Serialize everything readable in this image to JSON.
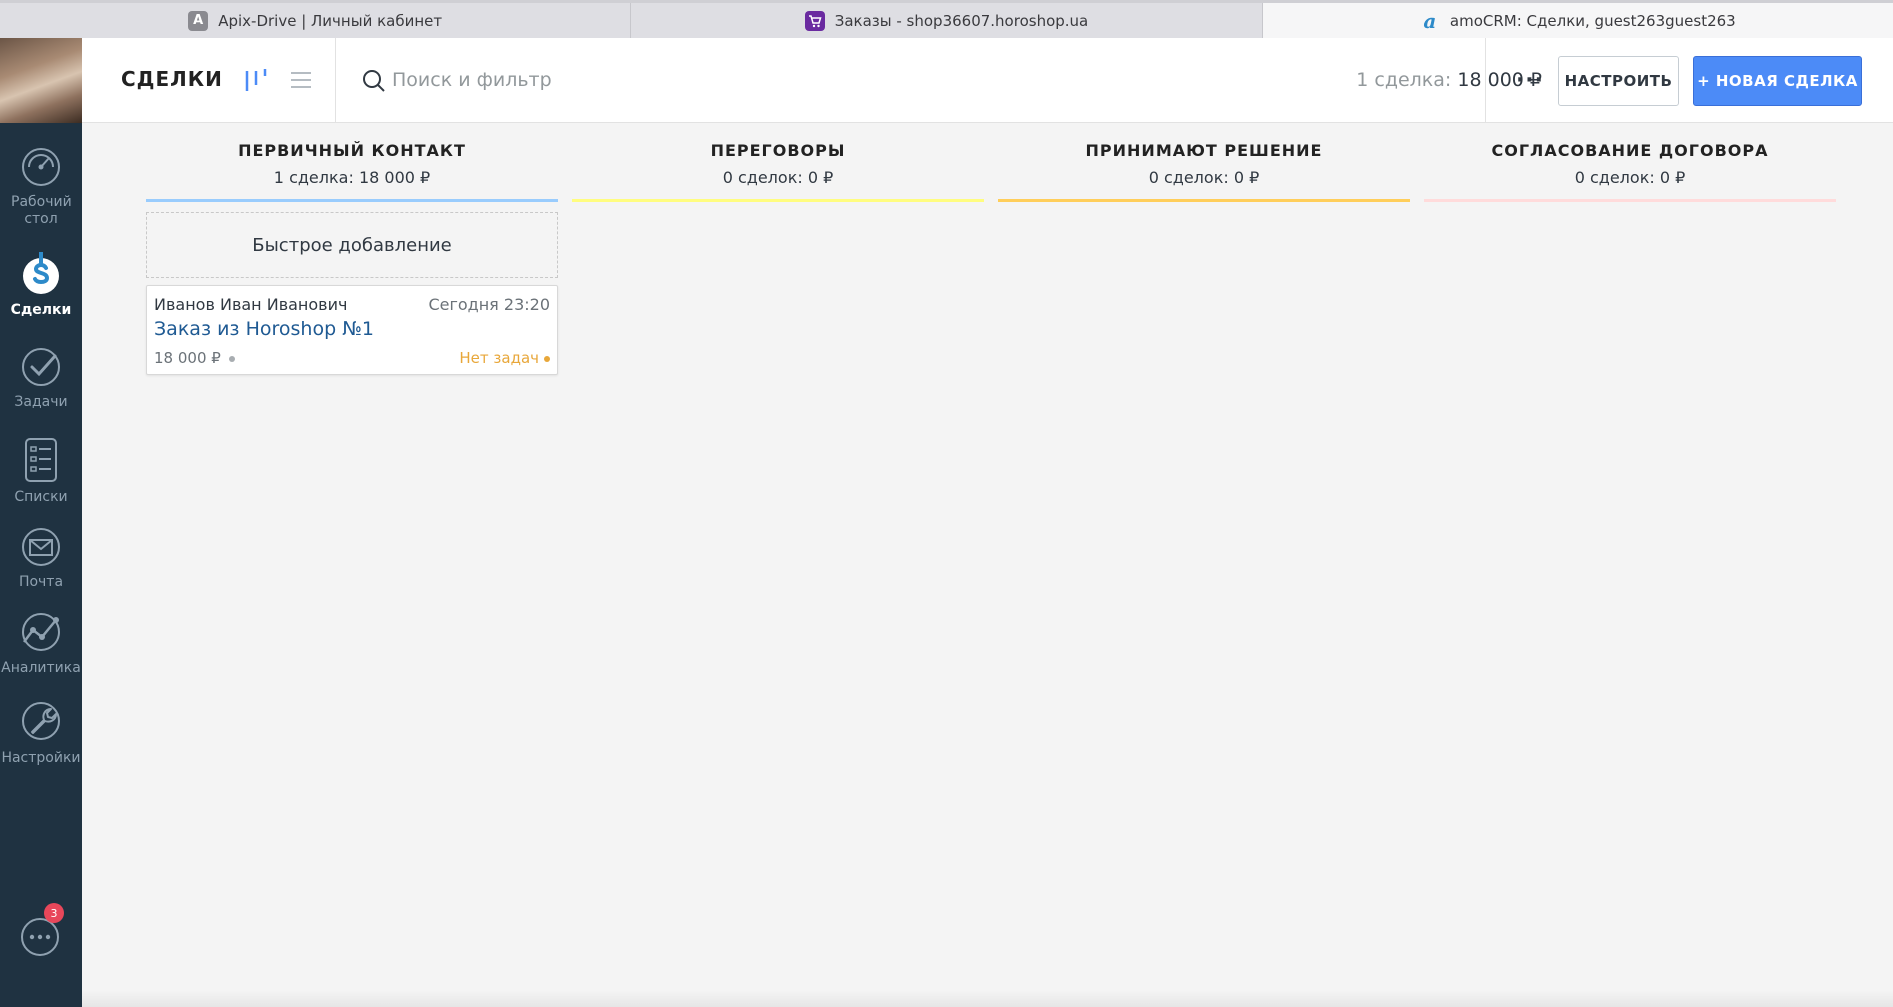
{
  "browser": {
    "tabs": [
      {
        "title": "Apix-Drive | Личный кабинет",
        "icon": "letter-a-icon",
        "favicon_text": "A"
      },
      {
        "title": "Заказы - shop36607.horoshop.ua",
        "icon": "cart-icon"
      },
      {
        "title": "amoCRM: Сделки, guest263guest263",
        "icon": "amo-logo-icon",
        "favicon_text": "a"
      }
    ]
  },
  "sidebar": {
    "items": [
      {
        "label": "Рабочий стол",
        "icon": "dashboard-icon",
        "active": false
      },
      {
        "label": "Сделки",
        "icon": "deals-icon",
        "active": true
      },
      {
        "label": "Задачи",
        "icon": "tasks-icon",
        "active": false
      },
      {
        "label": "Списки",
        "icon": "lists-icon",
        "active": false
      },
      {
        "label": "Почта",
        "icon": "mail-icon",
        "active": false
      },
      {
        "label": "Аналитика",
        "icon": "analytics-icon",
        "active": false
      },
      {
        "label": "Настройки",
        "icon": "settings-icon",
        "active": false
      }
    ],
    "chat_badge": "3"
  },
  "header": {
    "title": "СДЕЛКИ",
    "search_placeholder": "Поиск и фильтр",
    "summary_count": "1 сделка:",
    "summary_total": "18 000 ₽",
    "more_label": "···",
    "configure_label": "НАСТРОИТЬ",
    "new_deal_label": "+ НОВАЯ СДЕЛКА"
  },
  "pipeline": {
    "stages": [
      {
        "name": "ПЕРВИЧНЫЙ КОНТАКТ",
        "count_label": "1 сделка:",
        "total": "18 000 ₽",
        "color": "#99ccfd"
      },
      {
        "name": "ПЕРЕГОВОРЫ",
        "count_label": "0 сделок:",
        "total": "0 ₽",
        "color": "#fffd7f"
      },
      {
        "name": "ПРИНИМАЮТ РЕШЕНИЕ",
        "count_label": "0 сделок:",
        "total": "0 ₽",
        "color": "#ffce5a"
      },
      {
        "name": "СОГЛАСОВАНИЕ ДОГОВОРА",
        "count_label": "0 сделок:",
        "total": "0 ₽",
        "color": "#ffdbdb"
      }
    ],
    "quick_add_label": "Быстрое добавление",
    "card": {
      "contact": "Иванов Иван Иванович",
      "date": "Сегодня 23:20",
      "title": "Заказ из Horoshop №1",
      "price": "18 000 ₽",
      "tasks": "Нет задач"
    }
  },
  "colors": {
    "sidebar_bg": "#1f3241",
    "accent_blue": "#4c8bf7",
    "link_blue": "#1f5a93",
    "warning_orange": "#e8a73a",
    "badge_red": "#e8475a"
  }
}
